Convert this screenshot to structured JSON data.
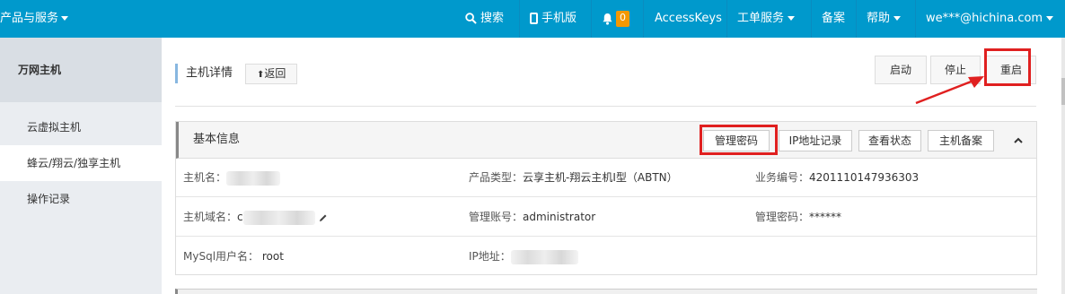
{
  "topbar": {
    "brand": "产品与服务",
    "search": "搜索",
    "mobile": "手机版",
    "notifications_count": "0",
    "accesskeys": "AccessKeys",
    "tickets": "工单服务",
    "beian": "备案",
    "help": "帮助",
    "user": "we***@hichina.com"
  },
  "sidebar": {
    "header": "万网主机",
    "items": [
      {
        "label": "云虚拟主机"
      },
      {
        "label": "蜂云/翔云/独享主机"
      },
      {
        "label": "操作记录"
      }
    ]
  },
  "main": {
    "title": "主机详情",
    "back_label": "返回",
    "actions": {
      "start": "启动",
      "stop": "停止",
      "restart": "重启"
    }
  },
  "panel": {
    "title": "基本信息",
    "buttons": {
      "manage_password": "管理密码",
      "ip_records": "IP地址记录",
      "view_status": "查看状态",
      "host_beian": "主机备案"
    },
    "rows": [
      {
        "c1_label": "主机名：",
        "c1_value": "",
        "c2_label": "产品类型：",
        "c2_value": "云享主机-翔云主机I型（ABTN）",
        "c3_label": "业务编号：",
        "c3_value": "4201110147936303"
      },
      {
        "c1_label": "主机域名：",
        "c1_value": "c",
        "c2_label": "管理账号：",
        "c2_value": "administrator",
        "c3_label": "管理密码：",
        "c3_value": "******"
      },
      {
        "c1_label": "MySql用户名：",
        "c1_value": "root",
        "c2_label": "IP地址：",
        "c2_value": ""
      }
    ]
  },
  "colors": {
    "topbar_bg": "#0099cc",
    "badge": "#f39800",
    "highlight": "#e02020"
  }
}
